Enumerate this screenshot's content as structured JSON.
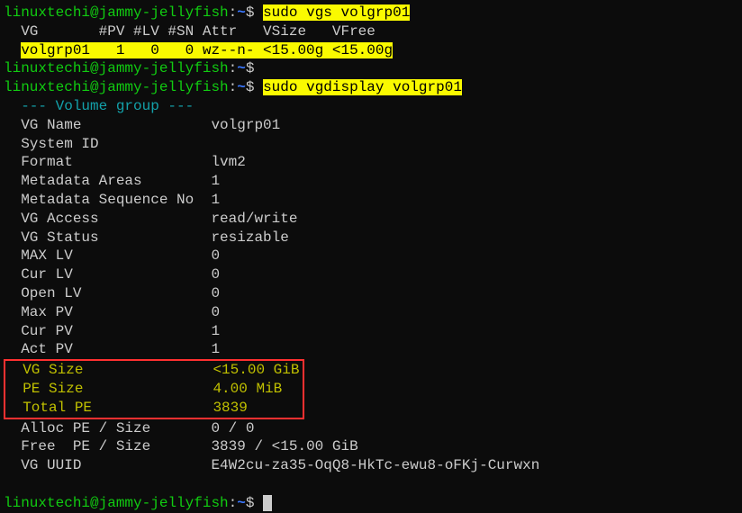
{
  "prompt": {
    "user": "linuxtechi",
    "host": "jammy-jellyfish",
    "path": "~",
    "sep1": "@",
    "sep2": ":",
    "dollar": "$ "
  },
  "commands": {
    "cmd1": "sudo vgs volgrp01",
    "cmd2": "sudo vgdisplay volgrp01"
  },
  "vgs": {
    "header": "  VG       #PV #LV #SN Attr   VSize   VFree",
    "row_pre": "  ",
    "row": "volgrp01   1   0   0 wz--n- <15.00g <15.00g"
  },
  "vgdisplay": {
    "title": "  --- Volume group ---",
    "rows": [
      {
        "label": "  VG Name              ",
        "value": " volgrp01"
      },
      {
        "label": "  System ID",
        "value": ""
      },
      {
        "label": "  Format               ",
        "value": " lvm2"
      },
      {
        "label": "  Metadata Areas       ",
        "value": " 1"
      },
      {
        "label": "  Metadata Sequence No ",
        "value": " 1"
      },
      {
        "label": "  VG Access            ",
        "value": " read/write"
      },
      {
        "label": "  VG Status            ",
        "value": " resizable"
      },
      {
        "label": "  MAX LV               ",
        "value": " 0"
      },
      {
        "label": "  Cur LV               ",
        "value": " 0"
      },
      {
        "label": "  Open LV              ",
        "value": " 0"
      },
      {
        "label": "  Max PV               ",
        "value": " 0"
      },
      {
        "label": "  Cur PV               ",
        "value": " 1"
      },
      {
        "label": "  Act PV               ",
        "value": " 1"
      }
    ],
    "boxed_rows": [
      {
        "label": "  VG Size              ",
        "value": " <15.00 GiB"
      },
      {
        "label": "  PE Size              ",
        "value": " 4.00 MiB"
      },
      {
        "label": "  Total PE             ",
        "value": " 3839"
      }
    ],
    "tail_rows": [
      {
        "label": "  Alloc PE / Size      ",
        "value": " 0 / 0"
      },
      {
        "label": "  Free  PE / Size      ",
        "value": " 3839 / <15.00 GiB"
      },
      {
        "label": "  VG UUID              ",
        "value": " E4W2cu-za35-OqQ8-HkTc-ewu8-oFKj-Curwxn"
      }
    ]
  }
}
